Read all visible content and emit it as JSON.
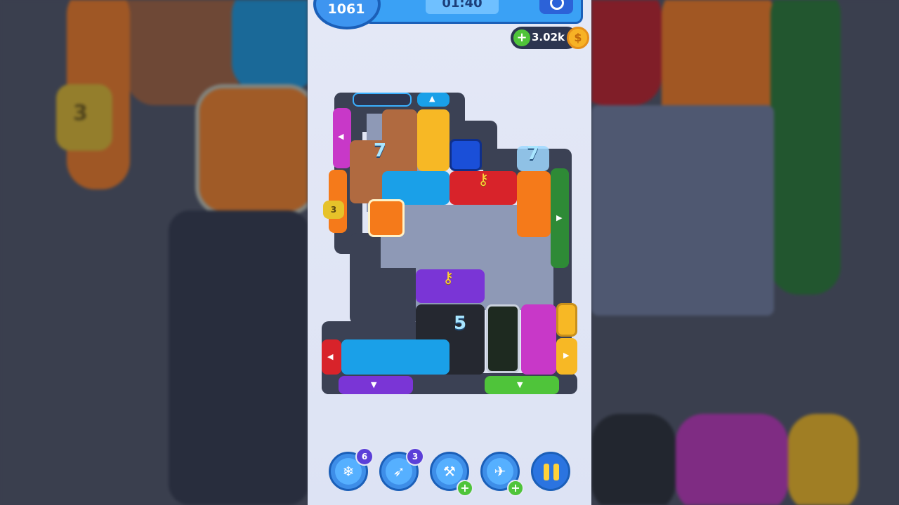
{
  "hud": {
    "level": "1061",
    "timer": "01:40",
    "coins": "3.02k",
    "coin_symbol": "$",
    "plus_symbol": "+"
  },
  "board": {
    "lock_counts": [
      "7",
      "7",
      "5"
    ],
    "chain_lock_count": "3"
  },
  "toolbar": {
    "boosters": [
      {
        "name": "freeze-booster",
        "count": "6",
        "icon": "snowflake-clock-icon"
      },
      {
        "name": "rocket-booster",
        "count": "3",
        "icon": "rocket-icon"
      },
      {
        "name": "hammer-booster",
        "count": "+",
        "icon": "hammer-icon"
      },
      {
        "name": "vacuum-booster",
        "count": "+",
        "icon": "vacuum-icon"
      }
    ]
  },
  "background": {
    "blurred_lock_count": "3"
  },
  "colors": {
    "blue": "#1aa0e8",
    "orange": "#f57a1a",
    "brown": "#b06a40",
    "yellow": "#f7b825",
    "red": "#d8232a",
    "purple": "#7a35d6",
    "magenta": "#c838c8",
    "green": "#2e8a36",
    "black": "#252830"
  }
}
